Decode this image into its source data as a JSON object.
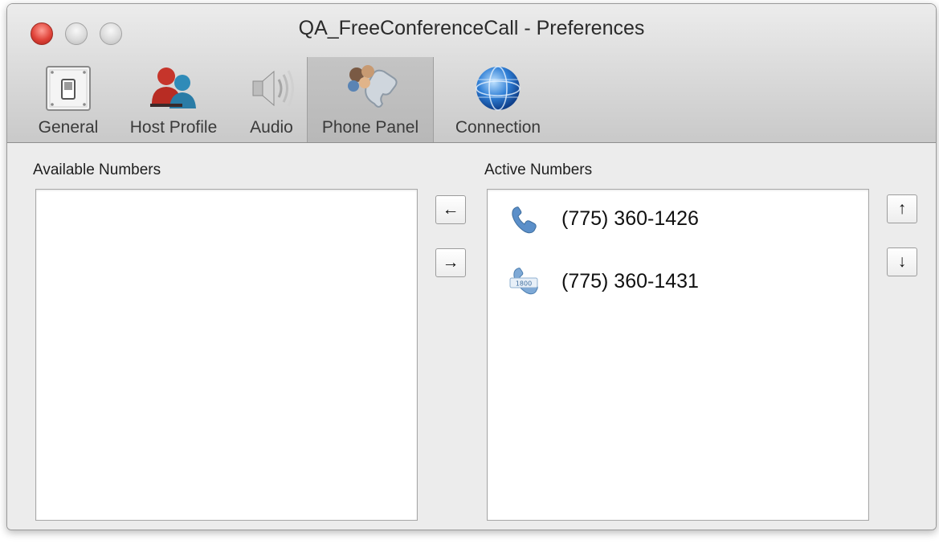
{
  "window": {
    "title": "QA_FreeConferenceCall - Preferences"
  },
  "toolbar": {
    "items": [
      {
        "label": "General",
        "icon": "toggle-switch-icon"
      },
      {
        "label": "Host Profile",
        "icon": "users-icon"
      },
      {
        "label": "Audio",
        "icon": "speaker-icon"
      },
      {
        "label": "Phone Panel",
        "icon": "phone-panel-icon"
      },
      {
        "label": "Connection",
        "icon": "globe-icon"
      }
    ],
    "selected": "Phone Panel"
  },
  "available": {
    "label": "Available Numbers",
    "items": []
  },
  "active": {
    "label": "Active Numbers",
    "items": [
      {
        "number": "(775) 360-1426",
        "icon": "phone-handset-icon"
      },
      {
        "number": "(775) 360-1431",
        "icon": "toll-free-phone-icon",
        "badge": "1800"
      }
    ]
  },
  "controls": {
    "move_left": "←",
    "move_right": "→",
    "move_up": "↑",
    "move_down": "↓"
  },
  "colors": {
    "phone_blue": "#5b8fc9",
    "close_red": "#e0443a",
    "globe_blue": "#2f7fd6"
  }
}
